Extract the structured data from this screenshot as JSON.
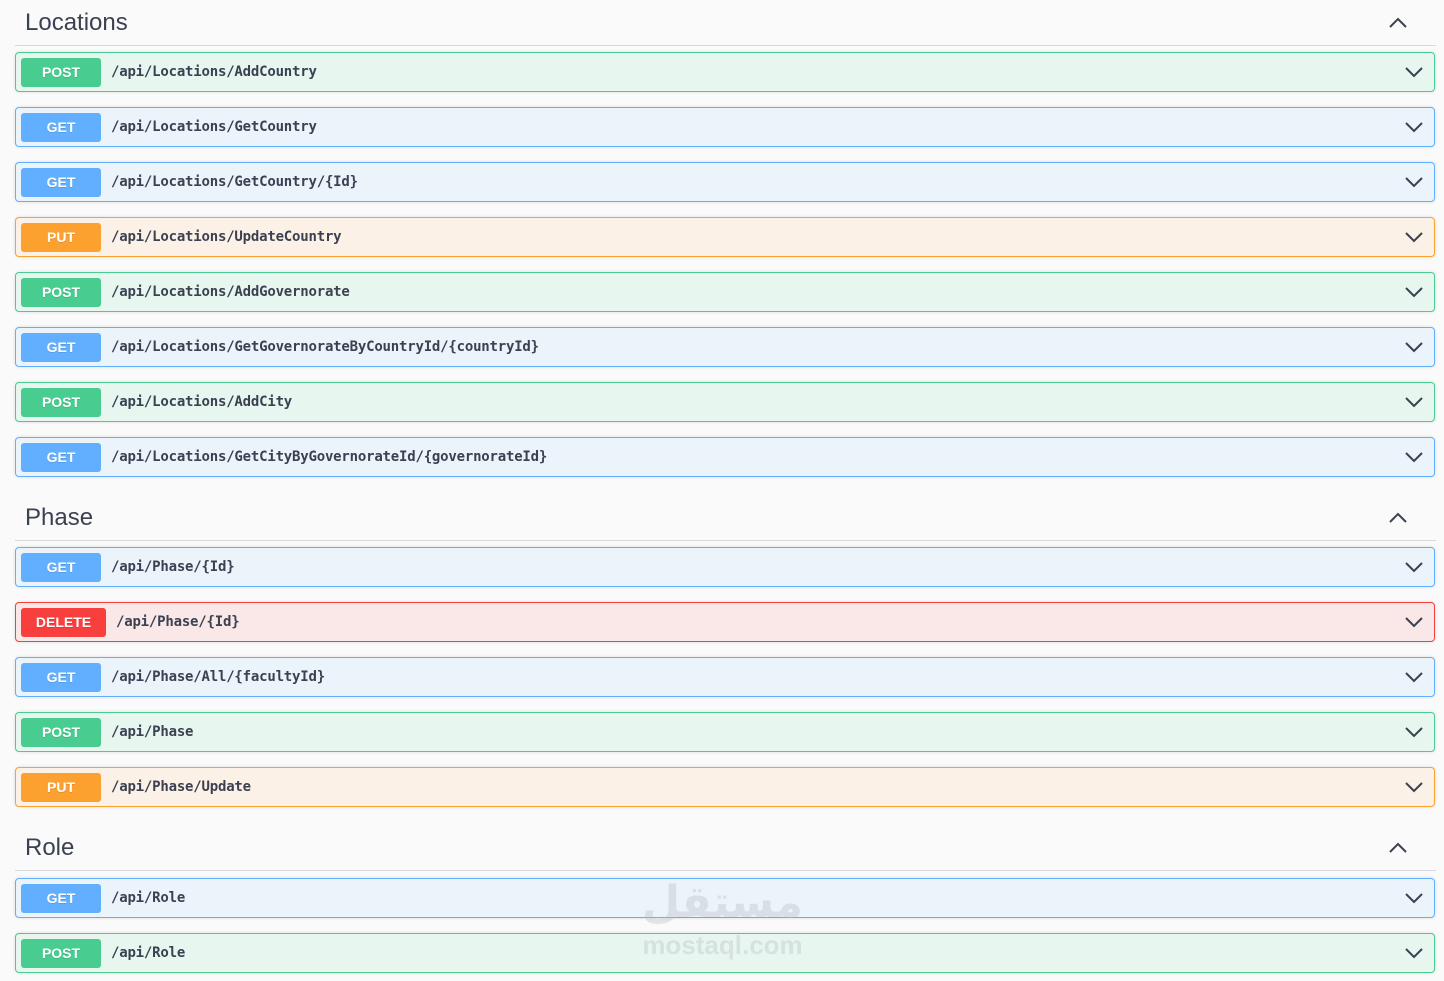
{
  "sections": [
    {
      "title": "Locations",
      "operations": [
        {
          "method": "POST",
          "path": "/api/Locations/AddCountry"
        },
        {
          "method": "GET",
          "path": "/api/Locations/GetCountry"
        },
        {
          "method": "GET",
          "path": "/api/Locations/GetCountry/{Id}"
        },
        {
          "method": "PUT",
          "path": "/api/Locations/UpdateCountry"
        },
        {
          "method": "POST",
          "path": "/api/Locations/AddGovernorate"
        },
        {
          "method": "GET",
          "path": "/api/Locations/GetGovernorateByCountryId/{countryId}"
        },
        {
          "method": "POST",
          "path": "/api/Locations/AddCity"
        },
        {
          "method": "GET",
          "path": "/api/Locations/GetCityByGovernorateId/{governorateId}"
        }
      ]
    },
    {
      "title": "Phase",
      "operations": [
        {
          "method": "GET",
          "path": "/api/Phase/{Id}"
        },
        {
          "method": "DELETE",
          "path": "/api/Phase/{Id}"
        },
        {
          "method": "GET",
          "path": "/api/Phase/All/{facultyId}"
        },
        {
          "method": "POST",
          "path": "/api/Phase"
        },
        {
          "method": "PUT",
          "path": "/api/Phase/Update"
        }
      ]
    },
    {
      "title": "Role",
      "operations": [
        {
          "method": "GET",
          "path": "/api/Role"
        },
        {
          "method": "POST",
          "path": "/api/Role"
        }
      ]
    }
  ],
  "icons": {
    "collapse": "chevron-up-icon",
    "expand": "chevron-down-icon"
  },
  "colors": {
    "GET": "#61affe",
    "POST": "#49cc90",
    "PUT": "#fca130",
    "DELETE": "#f93e3e"
  },
  "watermark": {
    "arabic": "مستقل",
    "latin": "mostaql.com"
  }
}
